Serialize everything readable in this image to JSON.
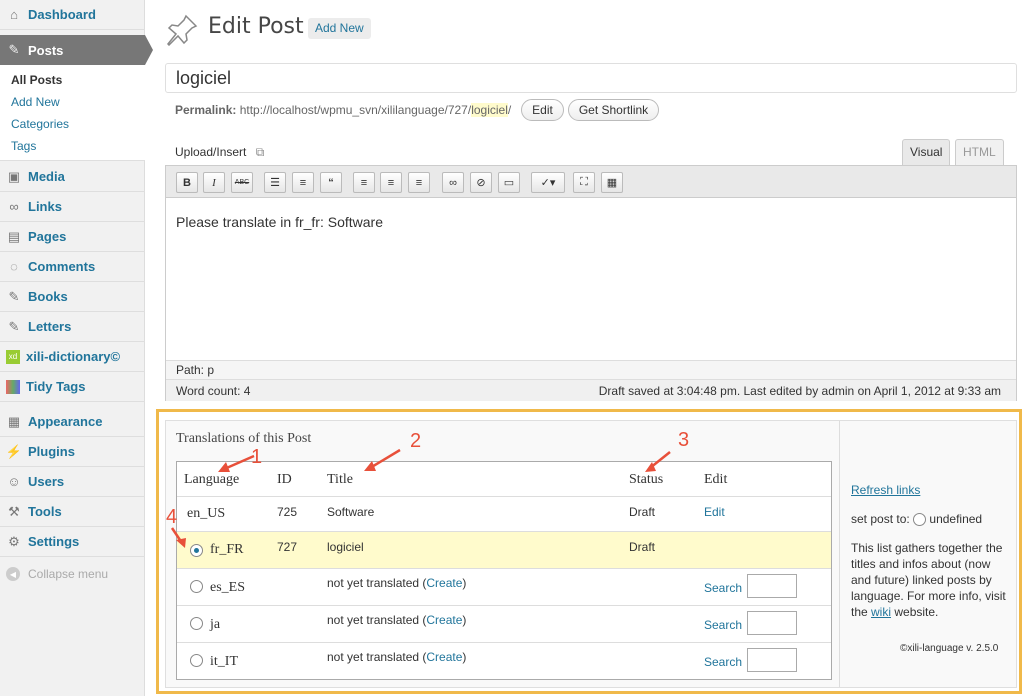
{
  "sidebar": {
    "items": [
      {
        "label": "Dashboard",
        "icon": "dashboard-icon"
      },
      {
        "label": "Posts",
        "icon": "pin-icon"
      },
      {
        "label": "Media",
        "icon": "media-icon"
      },
      {
        "label": "Links",
        "icon": "link-icon"
      },
      {
        "label": "Pages",
        "icon": "pages-icon"
      },
      {
        "label": "Comments",
        "icon": "comment-icon"
      },
      {
        "label": "Books",
        "icon": "pin-icon"
      },
      {
        "label": "Letters",
        "icon": "pin-icon"
      },
      {
        "label": "xili-dictionary©",
        "icon": "xili-icon"
      },
      {
        "label": "Tidy Tags",
        "icon": "tags-icon"
      },
      {
        "label": "Appearance",
        "icon": "appearance-icon"
      },
      {
        "label": "Plugins",
        "icon": "plugin-icon"
      },
      {
        "label": "Users",
        "icon": "users-icon"
      },
      {
        "label": "Tools",
        "icon": "tools-icon"
      },
      {
        "label": "Settings",
        "icon": "settings-icon"
      }
    ],
    "submenu": [
      "All Posts",
      "Add New",
      "Categories",
      "Tags"
    ],
    "collapse_label": "Collapse menu"
  },
  "header": {
    "title": "Edit Post",
    "add_new": "Add New"
  },
  "post": {
    "title_value": "logiciel",
    "permalink_label": "Permalink:",
    "permalink_base": "http://localhost/wpmu_svn/xililanguage/727/",
    "permalink_slug": "logiciel",
    "permalink_end": "/",
    "edit_btn": "Edit",
    "shortlink_btn": "Get Shortlink"
  },
  "editor": {
    "upload_label": "Upload/Insert",
    "tab_visual": "Visual",
    "tab_html": "HTML",
    "content": "Please translate in fr_fr: Software",
    "path": "Path: p",
    "word_count": "Word count: 4",
    "status": "Draft saved at 3:04:48 pm. Last edited by admin on April 1, 2012 at 9:33 am",
    "toolbar": [
      "B",
      "I",
      "ABC"
    ]
  },
  "translations": {
    "title": "Translations of this Post",
    "headers": {
      "language": "Language",
      "id": "ID",
      "title": "Title",
      "status": "Status",
      "edit": "Edit"
    },
    "rows": [
      {
        "lang": "en_US",
        "id": "725",
        "title": "Software",
        "status": "Draft",
        "edit": "Edit"
      },
      {
        "lang": "fr_FR",
        "id": "727",
        "title": "logiciel",
        "status": "Draft"
      },
      {
        "lang": "es_ES",
        "title_prefix": "not yet translated (",
        "create": "Create",
        "title_suffix": ")",
        "search": "Search"
      },
      {
        "lang": "ja",
        "title_prefix": "not yet translated (",
        "create": "Create",
        "title_suffix": ")",
        "search": "Search"
      },
      {
        "lang": "it_IT",
        "title_prefix": "not yet translated (",
        "create": "Create",
        "title_suffix": ")",
        "search": "Search"
      }
    ],
    "side": {
      "refresh": "Refresh links",
      "set_post_to": "set post to:",
      "undefined": "undefined",
      "info_prefix": "This list gathers together the titles and infos about (now and future) linked posts by language. For more info, visit the ",
      "wiki": "wiki",
      "info_suffix": " website.",
      "version": "©xili-language v. 2.5.0"
    }
  },
  "annotations": [
    "1",
    "2",
    "3",
    "4"
  ],
  "colors": {
    "accent": "#21759b",
    "highlight": "#f0b94a",
    "annotation": "#e8503a",
    "current_row": "#fffbcc"
  }
}
